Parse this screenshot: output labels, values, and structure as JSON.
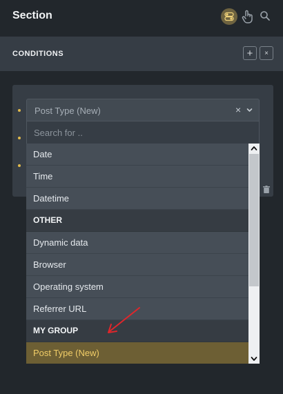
{
  "header": {
    "title": "Section"
  },
  "conditions": {
    "label": "CONDITIONS",
    "add_label": "+",
    "close_label": "×"
  },
  "select": {
    "value": "Post Type (New)",
    "clear_label": "×",
    "search_placeholder": "Search for .."
  },
  "options": [
    {
      "label": "Date",
      "kind": "item"
    },
    {
      "label": "Time",
      "kind": "item"
    },
    {
      "label": "Datetime",
      "kind": "item"
    },
    {
      "label": "OTHER",
      "kind": "group"
    },
    {
      "label": "Dynamic data",
      "kind": "item"
    },
    {
      "label": "Browser",
      "kind": "item"
    },
    {
      "label": "Operating system",
      "kind": "item"
    },
    {
      "label": "Referrer URL",
      "kind": "item"
    },
    {
      "label": "MY GROUP",
      "kind": "group"
    },
    {
      "label": "Post Type (New)",
      "kind": "item",
      "selected": true
    }
  ],
  "icons": {
    "toggle": "toggle-icon",
    "interaction": "hand-pointer-icon",
    "search": "search-icon",
    "trash": "trash-icon",
    "chevron": "chevron-down-icon"
  },
  "colors": {
    "accent": "#e0b94c",
    "selected_bg": "#6d5f34",
    "annotation_arrow": "#e0262b"
  }
}
